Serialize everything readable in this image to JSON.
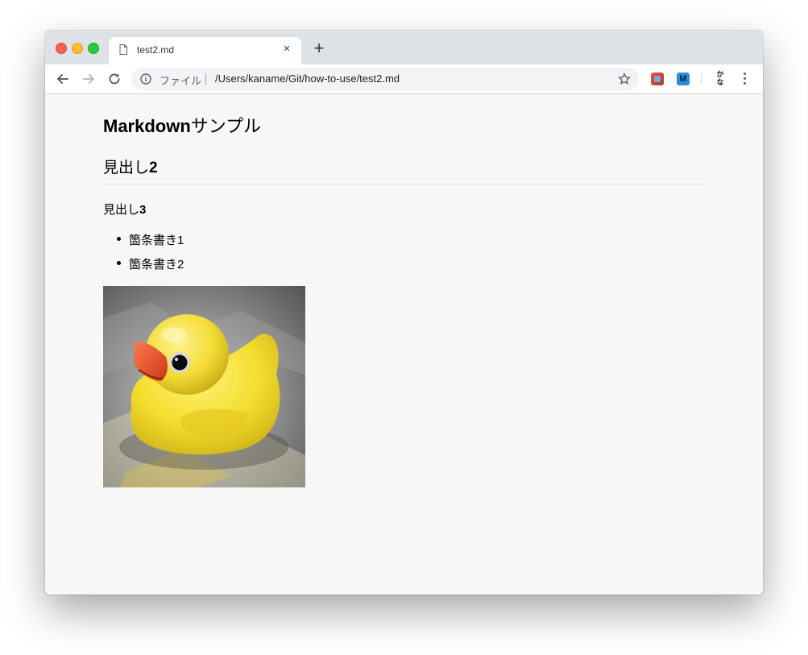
{
  "browser": {
    "tab": {
      "title": "test2.md",
      "close_glyph": "×",
      "icon": "file-icon"
    },
    "new_tab_glyph": "+",
    "toolbar": {
      "back_icon": "arrow-left-icon",
      "forward_icon": "arrow-right-icon",
      "reload_icon": "reload-icon",
      "omnibox": {
        "info_icon": "info-icon",
        "scheme_label": "ファイル",
        "url": "/Users/kaname/Git/how-to-use/test2.md",
        "bookmark_icon": "star-icon"
      },
      "extensions": [
        {
          "name": "extension-icon-red"
        },
        {
          "name": "extension-icon-m",
          "label": "M"
        },
        {
          "name": "extension-icon-kana",
          "label_top": "か",
          "label_bottom": "な"
        }
      ],
      "menu_icon": "kebab-menu-icon"
    }
  },
  "document": {
    "h1_latin": "Markdown",
    "h1_kana": "サンプル",
    "h2_text": "見出し",
    "h2_num": "2",
    "h3_text": "見出し",
    "h3_num": "3",
    "bullets": [
      "箇条書き1",
      "箇条書き2"
    ],
    "image": {
      "subject": "yellow rubber duck on crumpled aluminum foil"
    }
  },
  "colors": {
    "tabstrip_bg": "#dee1e6",
    "page_bg": "#f7f7f7",
    "duck_yellow": "#f5e03a",
    "beak_orange": "#e8502a"
  }
}
